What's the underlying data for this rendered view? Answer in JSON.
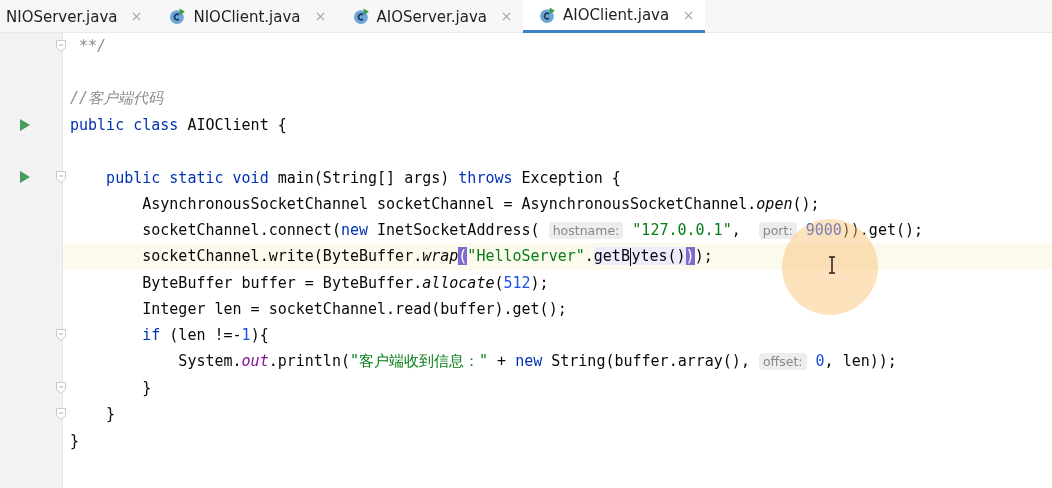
{
  "tabs": [
    {
      "label": "NIOServer.java",
      "icon": false,
      "selected": false
    },
    {
      "label": "NIOClient.java",
      "icon": true,
      "selected": false
    },
    {
      "label": "AIOServer.java",
      "icon": true,
      "selected": false
    },
    {
      "label": "AIOClient.java",
      "icon": true,
      "selected": true
    }
  ],
  "code_lines": [
    {
      "run": false,
      "fold": true,
      "current": false,
      "tokens": [
        {
          "kind": "doc",
          "text": " **/"
        }
      ]
    },
    {
      "run": false,
      "fold": false,
      "current": false
    },
    {
      "run": false,
      "fold": false,
      "current": false,
      "tokens": [
        {
          "kind": "comment",
          "text": "//客户端代码"
        }
      ]
    },
    {
      "run": true,
      "fold": false,
      "current": false,
      "tokens": [
        {
          "kind": "kw",
          "text": "public class"
        },
        {
          "kind": "plain",
          "text": " AIOClient {"
        }
      ]
    },
    {
      "run": false,
      "fold": false,
      "current": false
    },
    {
      "run": true,
      "fold": true,
      "current": false,
      "tokens": [
        {
          "kind": "kw",
          "text": "    public static void"
        },
        {
          "kind": "plain",
          "text": " main(String[] args) "
        },
        {
          "kind": "kw",
          "text": "throws"
        },
        {
          "kind": "plain",
          "text": " Exception {"
        }
      ]
    },
    {
      "run": false,
      "fold": false,
      "current": false,
      "tokens": [
        {
          "kind": "plain",
          "text": "        AsynchronousSocketChannel socketChannel = AsynchronousSocketChannel."
        },
        {
          "kind": "italic",
          "text": "open"
        },
        {
          "kind": "plain",
          "text": "();"
        }
      ]
    },
    {
      "run": false,
      "fold": false,
      "current": false,
      "tokens": [
        {
          "kind": "plain",
          "text": "        socketChannel.connect("
        },
        {
          "kind": "kw",
          "text": "new"
        },
        {
          "kind": "plain",
          "text": " InetSocketAddress( "
        },
        {
          "kind": "hint",
          "text": "hostname:"
        },
        {
          "kind": "str",
          "text": " \"127.0.0.1\""
        },
        {
          "kind": "plain",
          "text": ",  "
        },
        {
          "kind": "hint",
          "text": "port:"
        },
        {
          "kind": "num",
          "text": " 9000"
        },
        {
          "kind": "plain",
          "text": ")).get();"
        }
      ]
    },
    {
      "run": false,
      "fold": false,
      "current": true,
      "tokens": [
        {
          "kind": "plain",
          "text": "        socketChannel.write(ByteBuffer."
        },
        {
          "kind": "italic",
          "text": "wrap"
        },
        {
          "kind": "match",
          "text": "("
        },
        {
          "kind": "str",
          "text": "\"HelloServer\""
        },
        {
          "kind": "plain",
          "text": "."
        },
        {
          "kind": "usage",
          "text": "getB"
        },
        {
          "kind": "caret"
        },
        {
          "kind": "usage",
          "text": "ytes()"
        },
        {
          "kind": "match",
          "text": ")"
        },
        {
          "kind": "plain",
          "text": ");"
        }
      ]
    },
    {
      "run": false,
      "fold": false,
      "current": false,
      "tokens": [
        {
          "kind": "plain",
          "text": "        ByteBuffer buffer = ByteBuffer."
        },
        {
          "kind": "italic",
          "text": "allocate"
        },
        {
          "kind": "plain",
          "text": "("
        },
        {
          "kind": "num",
          "text": "512"
        },
        {
          "kind": "plain",
          "text": ");"
        }
      ]
    },
    {
      "run": false,
      "fold": false,
      "current": false,
      "tokens": [
        {
          "kind": "plain",
          "text": "        Integer len = socketChannel.read(buffer).get();"
        }
      ]
    },
    {
      "run": false,
      "fold": true,
      "current": false,
      "tokens": [
        {
          "kind": "kw",
          "text": "        if"
        },
        {
          "kind": "plain",
          "text": " (len !=-"
        },
        {
          "kind": "num",
          "text": "1"
        },
        {
          "kind": "plain",
          "text": "){"
        }
      ]
    },
    {
      "run": false,
      "fold": false,
      "current": false,
      "tokens": [
        {
          "kind": "plain",
          "text": "            System."
        },
        {
          "kind": "field",
          "text": "out"
        },
        {
          "kind": "plain",
          "text": ".println("
        },
        {
          "kind": "str",
          "text": "\"客户端收到信息：\""
        },
        {
          "kind": "plain",
          "text": " + "
        },
        {
          "kind": "kw",
          "text": "new"
        },
        {
          "kind": "plain",
          "text": " String(buffer.array(), "
        },
        {
          "kind": "hint",
          "text": "offset:"
        },
        {
          "kind": "num",
          "text": " 0"
        },
        {
          "kind": "plain",
          "text": ", len));"
        }
      ]
    },
    {
      "run": false,
      "fold": true,
      "current": false,
      "tokens": [
        {
          "kind": "plain",
          "text": "        }"
        }
      ]
    },
    {
      "run": false,
      "fold": true,
      "current": false,
      "tokens": [
        {
          "kind": "plain",
          "text": "    }"
        }
      ]
    },
    {
      "run": false,
      "fold": false,
      "current": false,
      "tokens": [
        {
          "kind": "plain",
          "text": "}"
        }
      ]
    }
  ]
}
